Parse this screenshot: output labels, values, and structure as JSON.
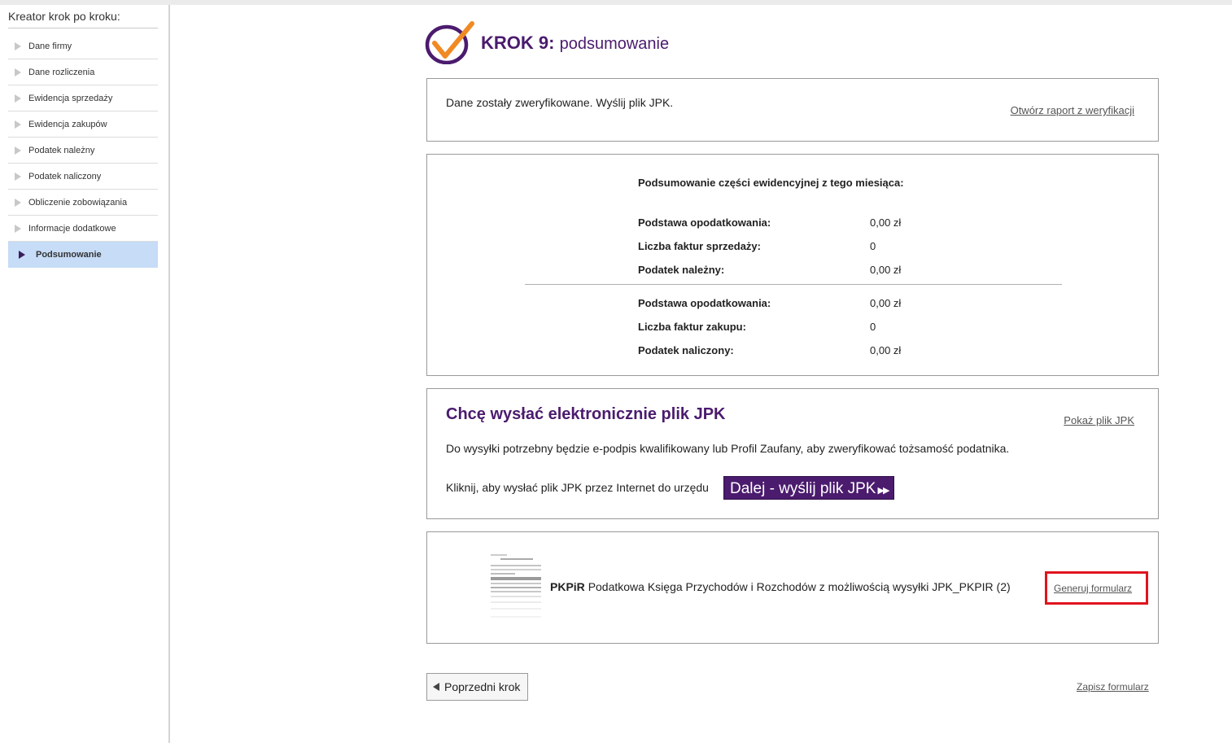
{
  "sidebar": {
    "title": "Kreator krok po kroku:",
    "items": [
      {
        "label": "Dane firmy"
      },
      {
        "label": "Dane rozliczenia"
      },
      {
        "label": "Ewidencja sprzedaży"
      },
      {
        "label": "Ewidencja zakupów"
      },
      {
        "label": "Podatek należny"
      },
      {
        "label": "Podatek naliczony"
      },
      {
        "label": "Obliczenie zobowiązania"
      },
      {
        "label": "Informacje dodatkowe"
      },
      {
        "label": "Podsumowanie",
        "active": true
      }
    ]
  },
  "header": {
    "step": "KROK 9:",
    "subtitle": "podsumowanie"
  },
  "verification": {
    "message": "Dane zostały zweryfikowane. Wyślij plik JPK.",
    "report_link": "Otwórz raport z weryfikacji"
  },
  "summary": {
    "heading": "Podsumowanie części ewidencyjnej z tego miesiąca:",
    "sales": [
      {
        "label": "Podstawa opodatkowania:",
        "value": "0,00 zł"
      },
      {
        "label": "Liczba faktur sprzedaży:",
        "value": "0"
      },
      {
        "label": "Podatek należny:",
        "value": "0,00 zł"
      }
    ],
    "purchases": [
      {
        "label": "Podstawa opodatkowania:",
        "value": "0,00 zł"
      },
      {
        "label": "Liczba faktur zakupu:",
        "value": "0"
      },
      {
        "label": "Podatek naliczony:",
        "value": "0,00 zł"
      }
    ]
  },
  "send": {
    "title": "Chcę wysłać elektronicznie plik JPK",
    "show_link": "Pokaż plik JPK",
    "description": "Do wysyłki potrzebny będzie e-podpis kwalifikowany lub Profil Zaufany, aby zweryfikować tożsamość podatnika.",
    "click_text": "Kliknij, aby wysłać plik JPK przez Internet do urzędu",
    "button_label": "Dalej - wyślij plik JPK",
    "button_icon": "fast-forward-icon"
  },
  "form": {
    "code": "PKPiR",
    "description": "Podatkowa Księga Przychodów i Rozchodów z możliwością wysyłki JPK_PKPIR (2)",
    "generate_link": "Generuj formularz",
    "highlight_color": "#e0141e"
  },
  "footer": {
    "prev_label": "Poprzedni krok",
    "save_link": "Zapisz formularz"
  },
  "colors": {
    "brand": "#4b1b6e",
    "accent": "#f08a24",
    "active_item": "#c6dcf7"
  }
}
